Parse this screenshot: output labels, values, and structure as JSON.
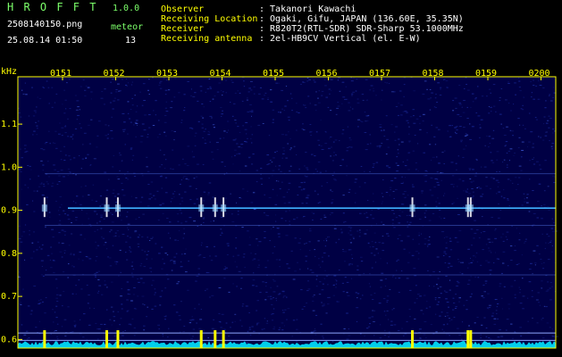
{
  "header": {
    "title": "H R O F F T",
    "version": "1.0.0",
    "filename": "2508140150.png",
    "meteor_label": "meteor",
    "datetime": "25.08.14 01:50",
    "meteor_count": "13",
    "info_labels": [
      "Observer",
      "Receiving Location",
      "Receiver",
      "Receiving antenna"
    ],
    "info_values": [
      ": Takanori Kawachi",
      ": Ogaki, Gifu, JAPAN (136.60E, 35.35N)",
      ": R820T2(RTL-SDR) SDR-Sharp 53.1000MHz",
      ": 2el-HB9CV Vertical (el. E-W)"
    ]
  },
  "chart_data": {
    "type": "heatmap",
    "title": "",
    "ylabel": "kHz",
    "x_tick_labels": [
      "0151",
      "0152",
      "0153",
      "0154",
      "0155",
      "0156",
      "0157",
      "0158",
      "0159",
      "0200"
    ],
    "y_tick_labels": [
      "1.1",
      "1.0",
      "0.9",
      "0.8",
      "0.7",
      "0.6"
    ],
    "y_tick_values": [
      1.1,
      1.0,
      0.9,
      0.8,
      0.7,
      0.6
    ],
    "ylim": [
      0.58,
      1.21
    ],
    "xlim_minutes": [
      0,
      9.68
    ],
    "carrier_khz": 0.905,
    "secondary_lines_khz": [
      0.865,
      0.985,
      0.75
    ],
    "meteor_echoes_minute": [
      0.48,
      1.6,
      1.8,
      3.3,
      3.55,
      3.7,
      7.1,
      8.1,
      8.15
    ],
    "colors": {
      "background": "#000044",
      "noise": "#1a2a9a",
      "carrier": "#3fb0ff",
      "echo": "#ffffff",
      "power": "#00e5ff",
      "power_peak": "#ffff00",
      "axis": "#ffff00"
    }
  }
}
